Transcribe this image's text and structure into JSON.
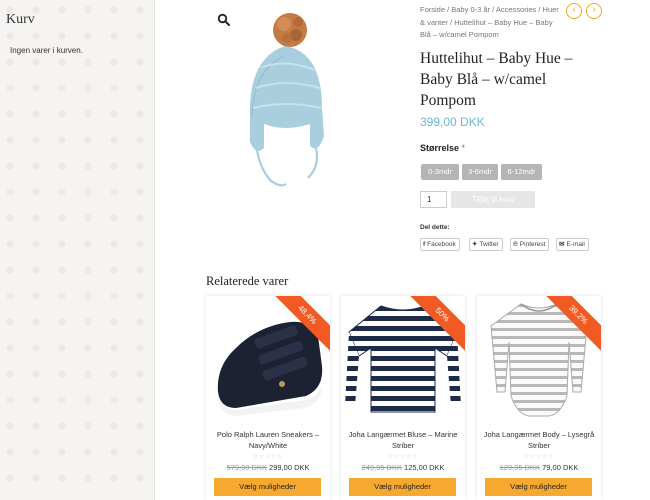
{
  "cart": {
    "title": "Kurv",
    "empty_text": "Ingen varer i kurven."
  },
  "header": {
    "search_icon": "search-icon",
    "breadcrumb": "Forside / Baby 0-3 år / Accessories / Huer & vanter / Huttelihut – Baby Hue – Baby Blå – w/camel Pompom",
    "prev_icon": "chevron-left-icon",
    "next_icon": "chevron-right-icon"
  },
  "product": {
    "title": "Huttelihut – Baby Hue – Baby Blå – w/camel Pompom",
    "price": "399,00 DKK",
    "size_label": "Størrelse",
    "size_required_mark": "*",
    "sizes": [
      "0-3mdr",
      "3-6mdr",
      "6-12mdr"
    ],
    "quantity": "1",
    "add_to_cart": "Tilføj til kurv",
    "share_label": "Del dette:",
    "share": [
      {
        "label": "Facebook",
        "icon": "facebook-icon"
      },
      {
        "label": "Twitter",
        "icon": "twitter-icon"
      },
      {
        "label": "Pinterest",
        "icon": "pinterest-icon"
      },
      {
        "label": "E-mail",
        "icon": "email-icon"
      }
    ]
  },
  "related": {
    "title": "Relaterede varer",
    "items": [
      {
        "badge": "48,4%",
        "name": "Polo Ralph Lauren Sneakers – Navy/White",
        "old_price": "579,00 DKK",
        "new_price": "299,00 DKK",
        "button": "Vælg muligheder"
      },
      {
        "badge": "50%",
        "name": "Joha Langærmet Bluse – Marine Striber",
        "old_price": "249,95 DKK",
        "new_price": "125,00 DKK",
        "button": "Vælg muligheder"
      },
      {
        "badge": "39,2%",
        "name": "Joha Langærmet Body – Lysegrå Striber",
        "old_price": "129,95 DKK",
        "new_price": "79,00 DKK",
        "button": "Vælg muligheder"
      }
    ]
  },
  "colors": {
    "accent": "#f7a92f",
    "sale_ribbon": "#f15a22",
    "price": "#6cb6d8"
  }
}
